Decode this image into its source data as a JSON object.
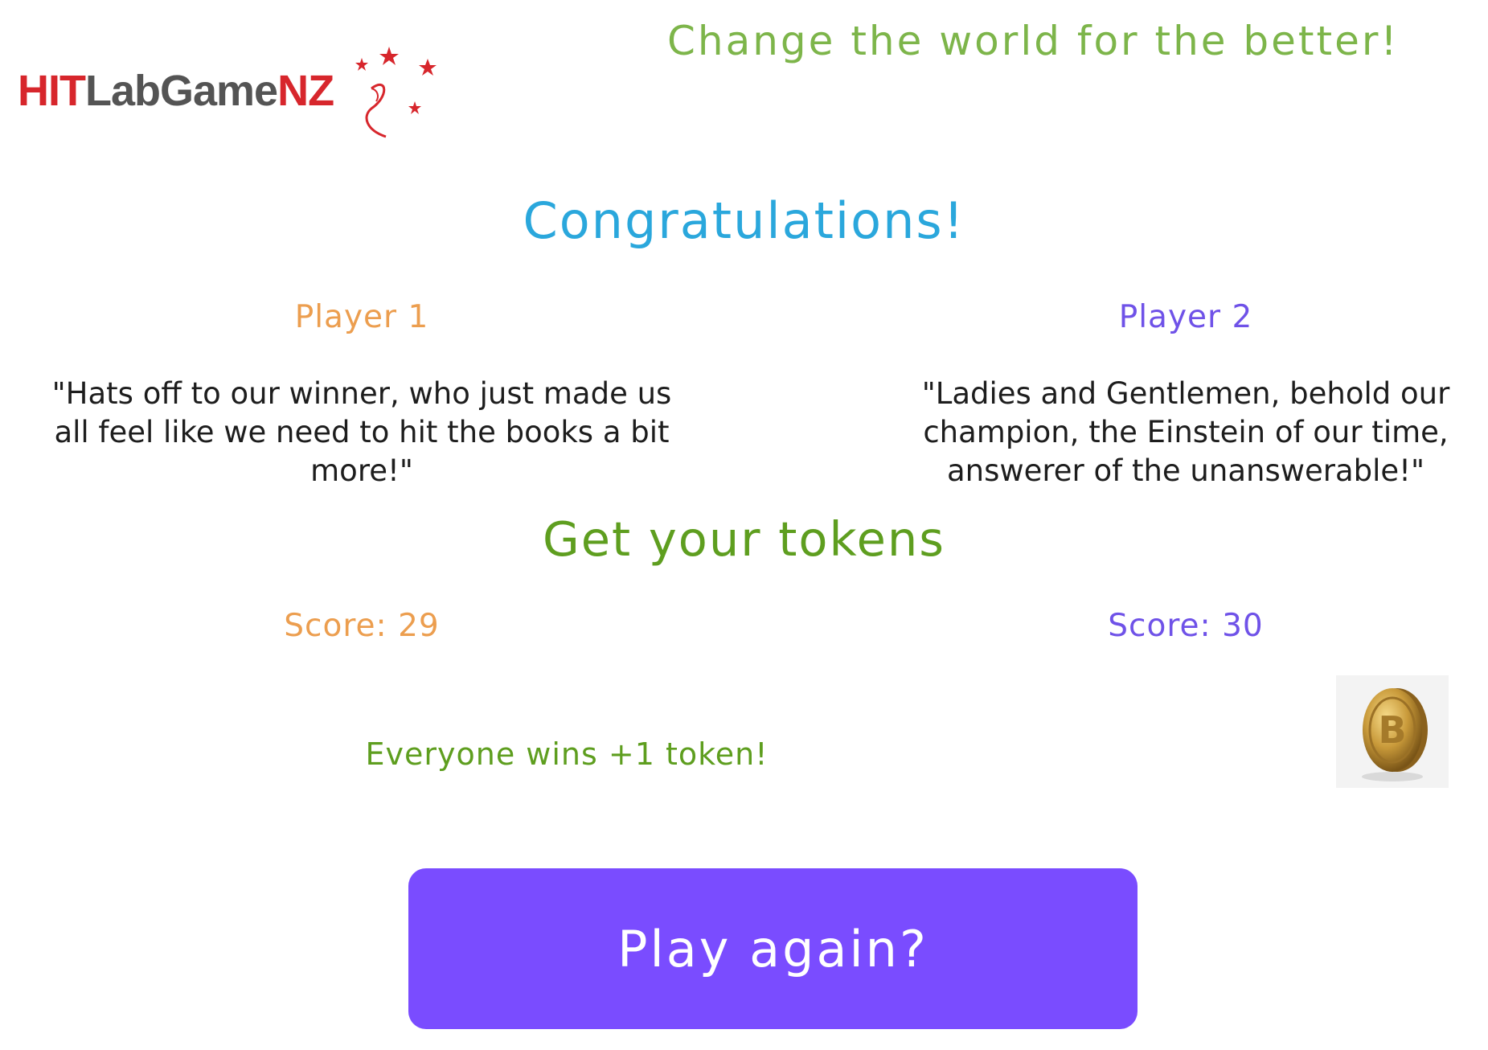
{
  "header": {
    "logo": {
      "part1": "HIT",
      "part2": "LabGame",
      "part3": "NZ",
      "colors": {
        "red": "#d7262c",
        "gray": "#545454"
      },
      "icon": "stars-swirl-icon"
    },
    "tagline": "Change the world for the better!"
  },
  "main": {
    "congrats_title": "Congratulations!",
    "players": [
      {
        "name": "Player 1",
        "quote": "\"Hats off to our winner, who just made us all feel like we need to hit the books a bit more!\"",
        "score_label": "Score: 29",
        "color": "#ec9e4f"
      },
      {
        "name": "Player 2",
        "quote": "\"Ladies and Gentlemen, behold our champion, the Einstein of our time, answerer of the unanswerable!\"",
        "score_label": "Score: 30",
        "color": "#6f52e8"
      }
    ],
    "tokens_title": "Get your tokens",
    "everyone_wins": "Everyone wins +1 token!",
    "coin_icon": "bitcoin-coin-icon",
    "play_again_label": "Play again?"
  },
  "colors": {
    "tagline": "#7db54a",
    "congrats": "#2aa7dc",
    "tokens_green": "#5e9e1f",
    "button_purple": "#7a4cff"
  }
}
